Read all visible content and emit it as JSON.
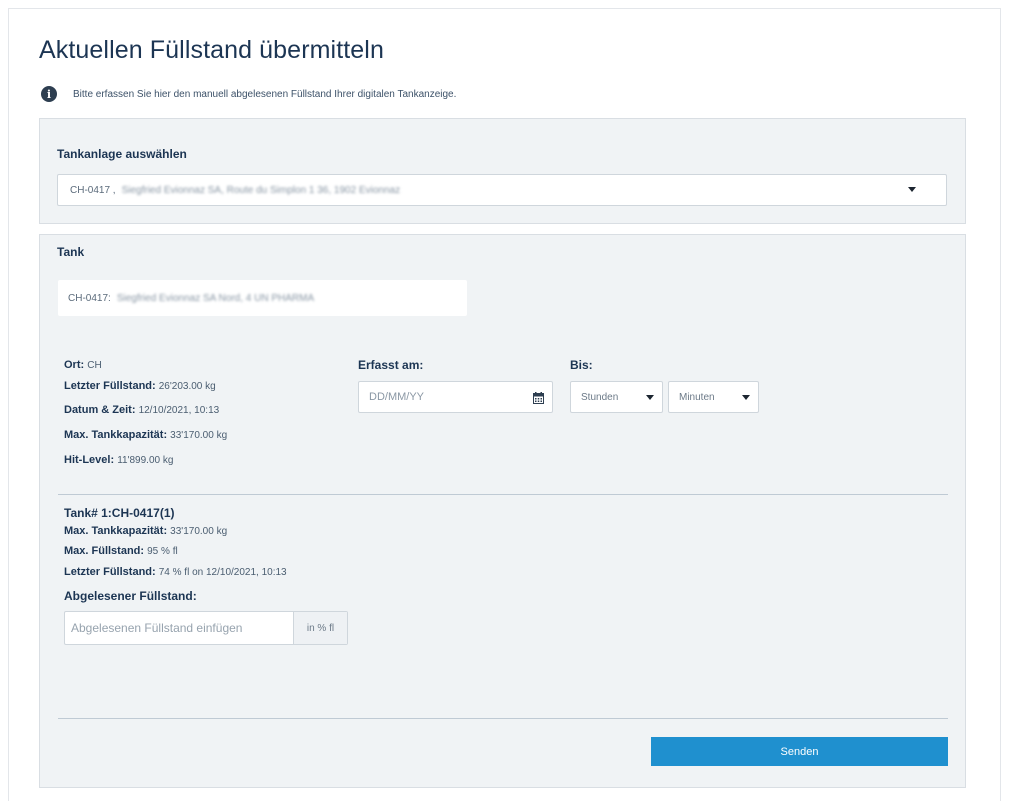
{
  "page": {
    "title": "Aktuellen Füllstand übermitteln",
    "info_text": "Bitte erfassen Sie hier den manuell abgelesenen Füllstand Ihrer digitalen Tankanzeige.",
    "icons": {
      "info": "info-icon",
      "calendar": "calendar-icon",
      "dropdown": "chevron-down-icon"
    }
  },
  "tank_plant": {
    "label": "Tankanlage auswählen",
    "selected_code": "CH-0417 ,",
    "selected_detail": "Siegfried Evionnaz SA, Route du Simplon 1 36, 1902 Evionnaz"
  },
  "tank": {
    "label": "Tank",
    "name_code": "CH-0417:",
    "name_detail": "Siegfried Evionnaz SA Nord, 4 UN PHARMA",
    "details": [
      {
        "label": "Ort:",
        "value": "CH"
      },
      {
        "label": "Letzter Füllstand:",
        "value": "26'203.00 kg"
      },
      {
        "label": "Datum & Zeit:",
        "value": "12/10/2021, 10:13"
      },
      {
        "label": "Max. Tankkapazität:",
        "value": "33'170.00 kg"
      },
      {
        "label": "Hit-Level:",
        "value": "11'899.00 kg"
      }
    ]
  },
  "form": {
    "captured_label": "Erfasst am:",
    "date_placeholder": "DD/MM/YY",
    "until_label": "Bis:",
    "hours_select": "Stunden",
    "minutes_select": "Minuten"
  },
  "tank_item": {
    "title": "Tank# 1:CH-0417(1)",
    "lines": [
      {
        "label": "Max. Tankkapazität:",
        "value": "33'170.00 kg"
      },
      {
        "label": "Max. Füllstand:",
        "value": "95 % fl"
      },
      {
        "label": "Letzter Füllstand:",
        "value": "74 % fl on 12/10/2021, 10:13"
      }
    ],
    "reading_label": "Abgelesener Füllstand:",
    "reading_placeholder": "Abgelesenen Füllstand einfügen",
    "reading_unit": "in % fl"
  },
  "actions": {
    "submit_label": "Senden",
    "submit_color": "#1f90cf"
  }
}
